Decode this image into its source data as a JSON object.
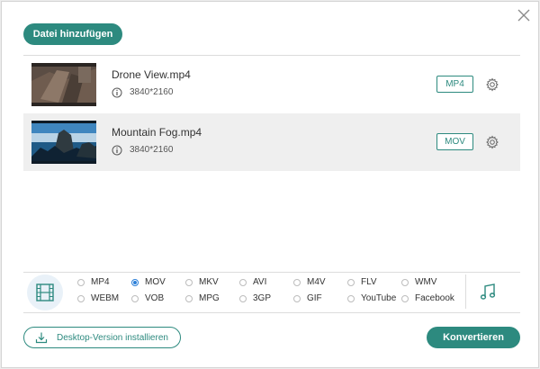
{
  "dialog": {
    "close_icon": "close-icon",
    "add_button_label": "Datei hinzufügen"
  },
  "files": [
    {
      "name": "Drone View.mp4",
      "resolution": "3840*2160",
      "format": "MP4",
      "selected": false,
      "thumbnail": "drone-thumbnail"
    },
    {
      "name": "Mountain Fog.mp4",
      "resolution": "3840*2160",
      "format": "MOV",
      "selected": true,
      "thumbnail": "mountain-thumbnail"
    }
  ],
  "formats": {
    "row1": [
      "MP4",
      "MOV",
      "MKV",
      "AVI",
      "M4V",
      "FLV",
      "WMV"
    ],
    "row2": [
      "WEBM",
      "VOB",
      "MPG",
      "3GP",
      "GIF",
      "YouTube",
      "Facebook"
    ],
    "selected": "MOV",
    "video_tab_icon": "film-icon",
    "audio_tab_icon": "music-note-icon"
  },
  "footer": {
    "desktop_button_label": "Desktop-Version installieren",
    "convert_button_label": "Konvertieren"
  },
  "colors": {
    "accent": "#2d8a7f",
    "radio_selected": "#2b7fd8",
    "selected_row_bg": "#efefef"
  }
}
